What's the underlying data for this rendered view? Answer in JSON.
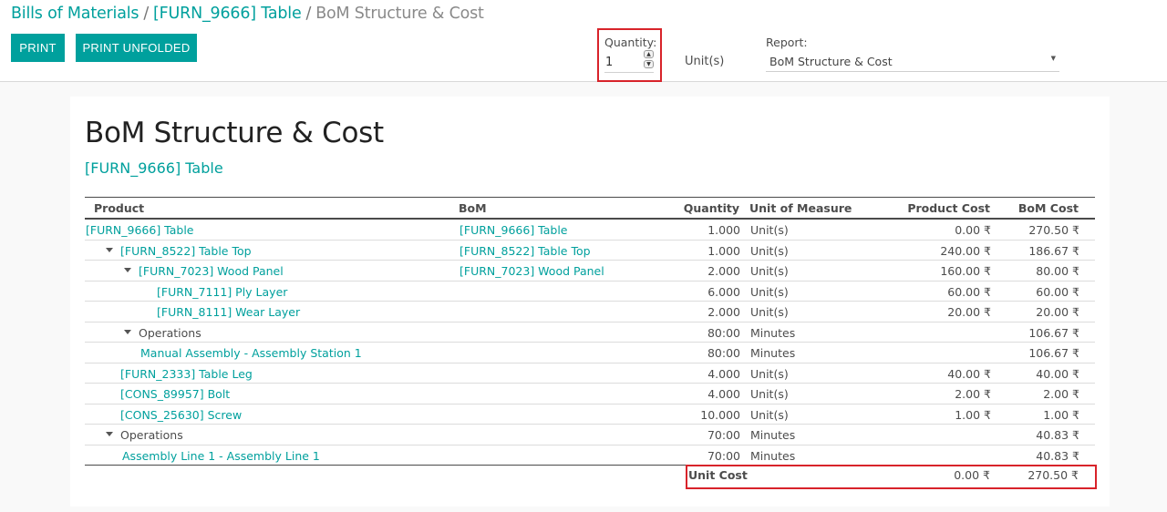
{
  "breadcrumb": {
    "items": [
      "Bills of Materials",
      "[FURN_9666] Table"
    ],
    "separator": "/",
    "active": "BoM Structure & Cost"
  },
  "buttons": {
    "print": "PRINT",
    "print_unfolded": "PRINT UNFOLDED"
  },
  "quantity": {
    "label": "Quantity:",
    "value": "1",
    "unit": "Unit(s)"
  },
  "report": {
    "label": "Report:",
    "selected": "BoM Structure & Cost"
  },
  "page": {
    "title": "BoM Structure & Cost",
    "subtitle": "[FURN_9666] Table"
  },
  "table": {
    "headers": {
      "product": "Product",
      "bom": "BoM",
      "quantity": "Quantity",
      "uom": "Unit of Measure",
      "product_cost": "Product Cost",
      "bom_cost": "BoM Cost"
    },
    "rows": [
      {
        "product": "[FURN_9666] Table",
        "bom": "[FURN_9666] Table",
        "quantity": "1.000",
        "uom": "Unit(s)",
        "product_cost": "0.00 ₹",
        "bom_cost": "270.50 ₹"
      },
      {
        "product": "[FURN_8522] Table Top",
        "bom": "[FURN_8522] Table Top",
        "quantity": "1.000",
        "uom": "Unit(s)",
        "product_cost": "240.00 ₹",
        "bom_cost": "186.67 ₹"
      },
      {
        "product": "[FURN_7023] Wood Panel",
        "bom": "[FURN_7023] Wood Panel",
        "quantity": "2.000",
        "uom": "Unit(s)",
        "product_cost": "160.00 ₹",
        "bom_cost": "80.00 ₹"
      },
      {
        "product": "[FURN_7111] Ply Layer",
        "bom": "",
        "quantity": "6.000",
        "uom": "Unit(s)",
        "product_cost": "60.00 ₹",
        "bom_cost": "60.00 ₹"
      },
      {
        "product": "[FURN_8111] Wear Layer",
        "bom": "",
        "quantity": "2.000",
        "uom": "Unit(s)",
        "product_cost": "20.00 ₹",
        "bom_cost": "20.00 ₹"
      },
      {
        "product": "Operations",
        "bom": "",
        "quantity": "80:00",
        "uom": "Minutes",
        "product_cost": "",
        "bom_cost": "106.67 ₹"
      },
      {
        "product": "Manual Assembly - Assembly Station 1",
        "bom": "",
        "quantity": "80:00",
        "uom": "Minutes",
        "product_cost": "",
        "bom_cost": "106.67 ₹"
      },
      {
        "product": "[FURN_2333] Table Leg",
        "bom": "",
        "quantity": "4.000",
        "uom": "Unit(s)",
        "product_cost": "40.00 ₹",
        "bom_cost": "40.00 ₹"
      },
      {
        "product": "[CONS_89957] Bolt",
        "bom": "",
        "quantity": "4.000",
        "uom": "Unit(s)",
        "product_cost": "2.00 ₹",
        "bom_cost": "2.00 ₹"
      },
      {
        "product": "[CONS_25630] Screw",
        "bom": "",
        "quantity": "10.000",
        "uom": "Unit(s)",
        "product_cost": "1.00 ₹",
        "bom_cost": "1.00 ₹"
      },
      {
        "product": "Operations",
        "bom": "",
        "quantity": "70:00",
        "uom": "Minutes",
        "product_cost": "",
        "bom_cost": "40.83 ₹"
      },
      {
        "product": "Assembly Line 1 - Assembly Line 1",
        "bom": "",
        "quantity": "70:00",
        "uom": "Minutes",
        "product_cost": "",
        "bom_cost": "40.83 ₹"
      }
    ],
    "footer": {
      "label": "Unit Cost",
      "product_cost": "0.00 ₹",
      "bom_cost": "270.50 ₹"
    }
  }
}
